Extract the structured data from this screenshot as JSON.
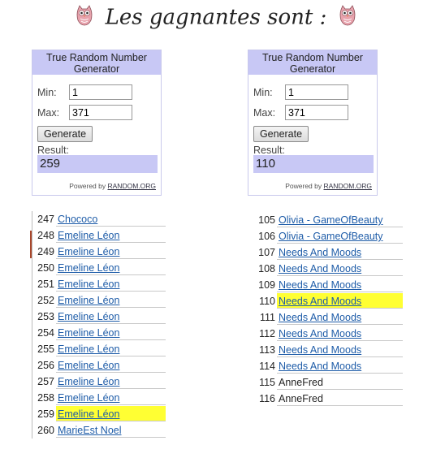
{
  "header": {
    "title": "Les gagnantes sont :"
  },
  "generators": [
    {
      "title": "True Random Number Generator",
      "min_label": "Min:",
      "min_value": "1",
      "max_label": "Max:",
      "max_value": "371",
      "button": "Generate",
      "result_label": "Result:",
      "result": "259",
      "powered_by": "Powered by",
      "powered_link": "RANDOM.ORG"
    },
    {
      "title": "True Random Number Generator",
      "min_label": "Min:",
      "min_value": "1",
      "max_label": "Max:",
      "max_value": "371",
      "button": "Generate",
      "result_label": "Result:",
      "result": "110",
      "powered_by": "Powered by",
      "powered_link": "RANDOM.ORG"
    }
  ],
  "left_sheet": [
    {
      "num": "247",
      "name": "Chococo",
      "link": true,
      "highlight": false
    },
    {
      "num": "248",
      "name": "Emeline Léon",
      "link": true,
      "highlight": false
    },
    {
      "num": "249",
      "name": "Emeline Léon",
      "link": true,
      "highlight": false
    },
    {
      "num": "250",
      "name": "Emeline Léon",
      "link": true,
      "highlight": false
    },
    {
      "num": "251",
      "name": "Emeline Léon",
      "link": true,
      "highlight": false
    },
    {
      "num": "252",
      "name": "Emeline Léon",
      "link": true,
      "highlight": false
    },
    {
      "num": "253",
      "name": "Emeline Léon",
      "link": true,
      "highlight": false
    },
    {
      "num": "254",
      "name": "Emeline Léon",
      "link": true,
      "highlight": false
    },
    {
      "num": "255",
      "name": "Emeline Léon",
      "link": true,
      "highlight": false
    },
    {
      "num": "256",
      "name": "Emeline Léon",
      "link": true,
      "highlight": false
    },
    {
      "num": "257",
      "name": "Emeline Léon",
      "link": true,
      "highlight": false
    },
    {
      "num": "258",
      "name": "Emeline Léon",
      "link": true,
      "highlight": false
    },
    {
      "num": "259",
      "name": "Emeline Léon",
      "link": true,
      "highlight": true
    },
    {
      "num": "260",
      "name": "MarieEst Noel",
      "link": true,
      "highlight": false
    }
  ],
  "right_sheet": [
    {
      "num": "105",
      "name": "Olivia - GameOfBeauty",
      "link": true,
      "highlight": false
    },
    {
      "num": "106",
      "name": "Olivia - GameOfBeauty",
      "link": true,
      "highlight": false
    },
    {
      "num": "107",
      "name": "Needs And Moods",
      "link": true,
      "highlight": false
    },
    {
      "num": "108",
      "name": "Needs And Moods",
      "link": true,
      "highlight": false
    },
    {
      "num": "109",
      "name": "Needs And Moods",
      "link": true,
      "highlight": false
    },
    {
      "num": "110",
      "name": "Needs And Moods",
      "link": true,
      "highlight": true
    },
    {
      "num": "111",
      "name": "Needs And Moods",
      "link": true,
      "highlight": false
    },
    {
      "num": "112",
      "name": "Needs And Moods",
      "link": true,
      "highlight": false
    },
    {
      "num": "113",
      "name": "Needs And Moods",
      "link": true,
      "highlight": false
    },
    {
      "num": "114",
      "name": "Needs And Moods",
      "link": true,
      "highlight": false
    },
    {
      "num": "115",
      "name": "AnneFred",
      "link": false,
      "highlight": false
    },
    {
      "num": "116",
      "name": "AnneFred",
      "link": false,
      "highlight": false
    }
  ],
  "colors": {
    "accent": "#c8c8f5",
    "highlight": "#ffff33",
    "link": "#1e5ca8"
  },
  "icons": [
    "owl-icon",
    "owl-icon"
  ]
}
